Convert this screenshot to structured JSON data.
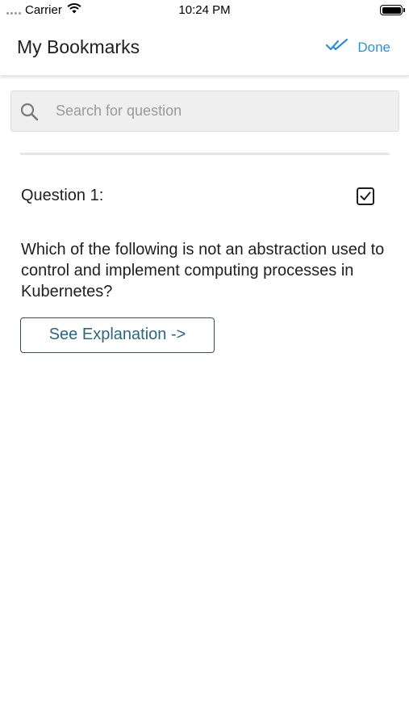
{
  "status_bar": {
    "carrier": "Carrier",
    "time": "10:24 PM"
  },
  "header": {
    "title": "My Bookmarks",
    "done_label": "Done",
    "done_icon": "double-check-icon"
  },
  "search": {
    "placeholder": "Search for question",
    "value": ""
  },
  "questions": [
    {
      "label": "Question 1:",
      "bookmarked": true,
      "text": "Which of the following is not an abstraction used to control and implement computing processes in Kubernetes?",
      "explanation_button": "See Explanation ->"
    }
  ],
  "colors": {
    "accent": "#2f8fd6",
    "button_text": "#2c6680",
    "button_border": "#3a4f5c"
  }
}
